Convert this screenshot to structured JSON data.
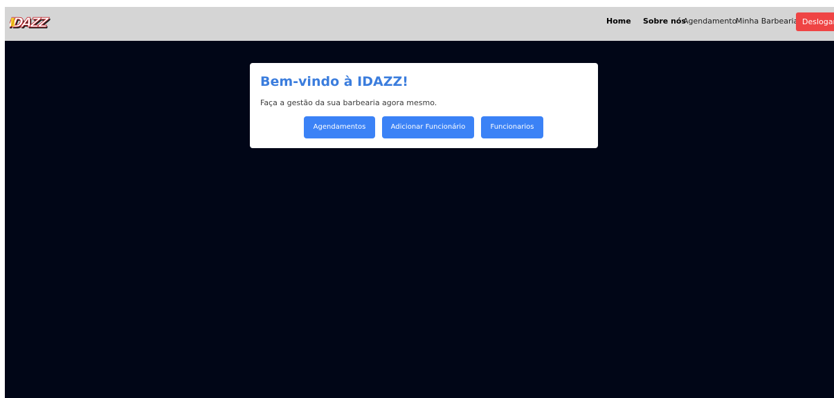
{
  "brand": {
    "logo_text": "IDAZZ"
  },
  "nav": {
    "home": "Home",
    "about": "Sobre nós",
    "booking": "Agendamento",
    "my_shop": "Minha Barbearia",
    "logout": "Deslogar"
  },
  "card": {
    "title": "Bem-vindo à IDAZZ!",
    "subtitle": "Faça a gestão da sua barbearia agora mesmo.",
    "buttons": {
      "appointments": "Agendamentos",
      "add_employee": "Adicionar Funcionário",
      "employees": "Funcionarios"
    }
  },
  "colors": {
    "navbar_bg": "#d5d5d5",
    "page_bg": "#010617",
    "accent": "#3b82f6",
    "title": "#3b7ddd",
    "danger": "#ef4444"
  }
}
